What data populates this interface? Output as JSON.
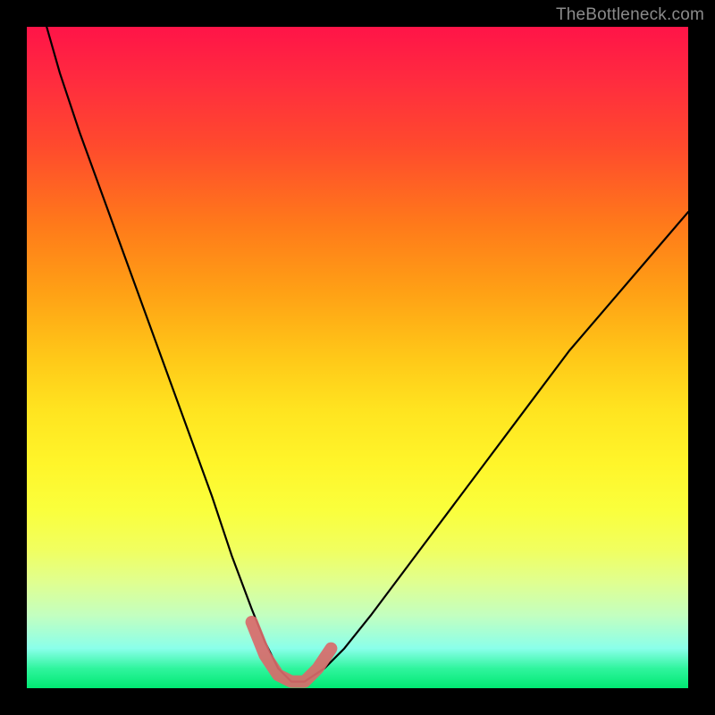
{
  "watermark": "TheBottleneck.com",
  "chart_data": {
    "type": "line",
    "title": "",
    "xlabel": "",
    "ylabel": "",
    "xlim": [
      0,
      100
    ],
    "ylim": [
      0,
      100
    ],
    "series": [
      {
        "name": "bottleneck-curve",
        "x": [
          3,
          5,
          8,
          12,
          16,
          20,
          24,
          28,
          31,
          34,
          36,
          38,
          40,
          42,
          45,
          48,
          52,
          58,
          64,
          70,
          76,
          82,
          88,
          94,
          100
        ],
        "y": [
          100,
          93,
          84,
          73,
          62,
          51,
          40,
          29,
          20,
          12,
          7,
          3,
          1,
          1,
          3,
          6,
          11,
          19,
          27,
          35,
          43,
          51,
          58,
          65,
          72
        ]
      },
      {
        "name": "highlight-segment",
        "x": [
          34,
          36,
          38,
          40,
          42,
          44,
          46
        ],
        "y": [
          10,
          5,
          2,
          1,
          1,
          3,
          6
        ]
      }
    ]
  }
}
